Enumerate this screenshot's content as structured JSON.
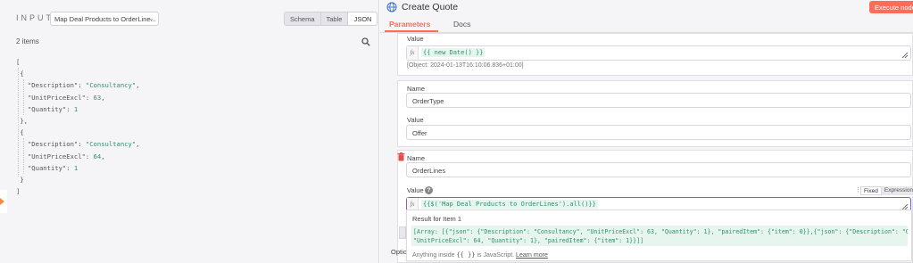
{
  "left_panel": {
    "input_label": "INPUT",
    "node_select_value": "Map Deal Products to OrderLine...",
    "view_tabs": [
      "Schema",
      "Table",
      "JSON"
    ],
    "active_view": "JSON",
    "items_count": "2 items",
    "search_icon": "search-icon",
    "json_lines": {
      "l0": "[",
      "l1": "{",
      "l2k": "\"Description\"",
      "l2v": "\"Consultancy\"",
      "l3k": "\"UnitPriceExcl\"",
      "l3v": "63",
      "l4k": "\"Quantity\"",
      "l4v": "1",
      "l5": "},",
      "l6": "{",
      "l7k": "\"Description\"",
      "l7v": "\"Consultancy\"",
      "l8k": "\"UnitPriceExcl\"",
      "l8v": "64",
      "l9k": "\"Quantity\"",
      "l9v": "1",
      "l10": "}",
      "l11": "]"
    }
  },
  "right_panel": {
    "title": "Create Quote",
    "title_icon": "globe-icon",
    "execute_button": "Execute node",
    "tabs": [
      "Parameters",
      "Docs"
    ],
    "active_tab": "Parameters",
    "fields": {
      "value1_label": "Value",
      "value1_expr": "{{ new Date() }}",
      "value1_hint": "[Object: 2024-01-13T16:10:06.836+01:00]",
      "name2_label": "Name",
      "name2_value": "OrderType",
      "value2_label": "Value",
      "value2_value": "Offer",
      "name3_label": "Name",
      "name3_value": "OrderLines",
      "value3_label": "Value",
      "value3_expr": "{{$('Map Deal Products to OrderLines').all()}}",
      "fixed_label": "Fixed",
      "expression_label": "Expression"
    },
    "result": {
      "title": "Result for Item 1",
      "line1": "[Array: [{\"json\": {\"Description\": \"Consultancy\", \"UnitPriceExcl\": 63, \"Quantity\": 1}, \"pairedItem\": {\"item\": 0}},{\"json\": {\"Description\": \"Consultancy\",",
      "line2": "\"UnitPriceExcl\": 64, \"Quantity\": 1}, \"pairedItem\": {\"item\": 1}}]]",
      "foot_prefix": "Anything inside",
      "foot_code": "{{ }}",
      "foot_mid": "is JavaScript.",
      "foot_link": "Learn more"
    },
    "options_label": "Optio"
  },
  "colors": {
    "accent": "#ff6d5a",
    "expression_green": "#2f8f6f",
    "expression_bg": "#e6f6ee",
    "input_arrow": "#ff8a3d"
  }
}
